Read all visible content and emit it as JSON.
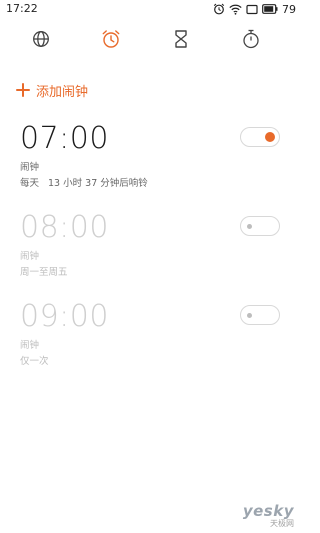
{
  "status_bar": {
    "time": "17:22",
    "battery_level": "79",
    "icons": [
      "alarm-clock-icon",
      "wifi-icon",
      "cast-icon",
      "battery-icon"
    ]
  },
  "tabs": [
    {
      "name": "world-clock",
      "icon": "globe-icon",
      "active": false
    },
    {
      "name": "alarm",
      "icon": "alarm-clock-icon",
      "active": true
    },
    {
      "name": "timer",
      "icon": "hourglass-icon",
      "active": false
    },
    {
      "name": "stopwatch",
      "icon": "stopwatch-icon",
      "active": false
    }
  ],
  "add_alarm": {
    "label": "添加闹钟",
    "icon": "plus-icon"
  },
  "alarms": [
    {
      "time": "07:00",
      "name": "闹钟",
      "repeat": "每天",
      "next_ring": "13 小时 37 分钟后响铃",
      "enabled": true
    },
    {
      "time": "08:00",
      "name": "闹钟",
      "repeat": "周一至周五",
      "next_ring": "",
      "enabled": false
    },
    {
      "time": "09:00",
      "name": "闹钟",
      "repeat": "仅一次",
      "next_ring": "",
      "enabled": false
    }
  ],
  "watermark": {
    "brand": "yesky",
    "sub": "天极网"
  },
  "colors": {
    "accent": "#e86a2b",
    "inactive_text": "#cfcfcf",
    "toggle_border": "#d8d8d8"
  }
}
